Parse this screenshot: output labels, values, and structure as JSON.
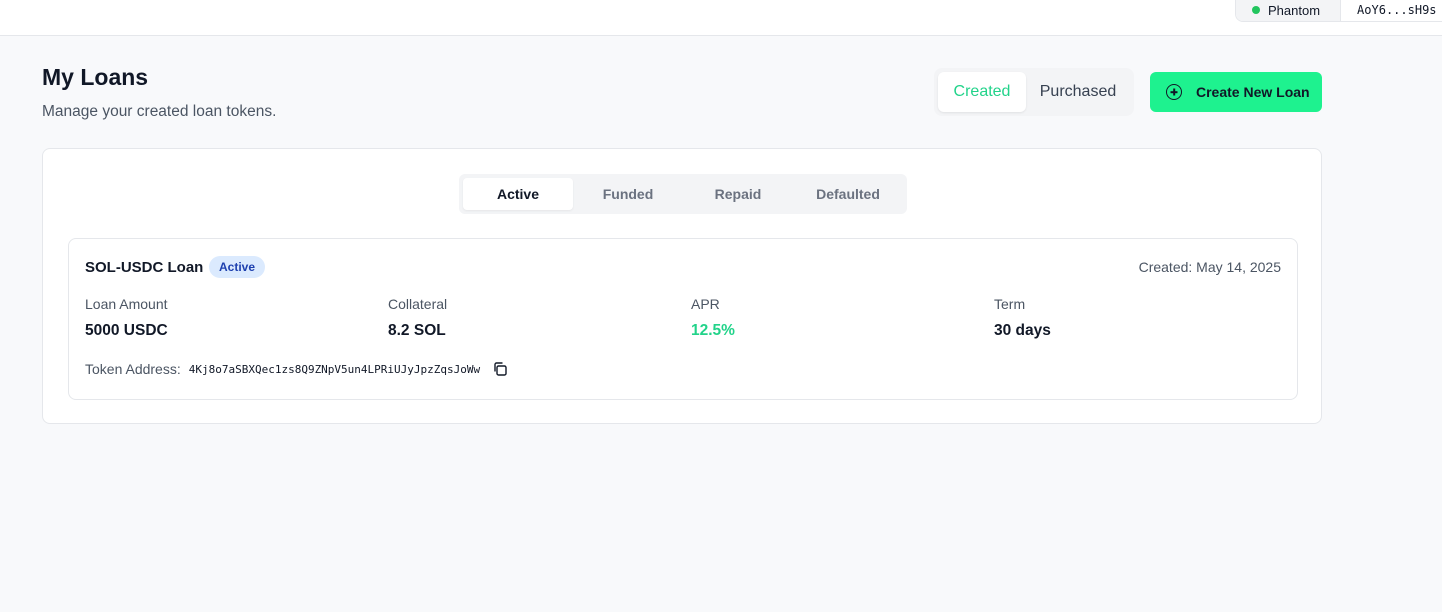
{
  "wallet": {
    "provider": "Phantom",
    "address": "AoY6...sH9s"
  },
  "header": {
    "title": "My Loans",
    "subtitle": "Manage your created loan tokens."
  },
  "view_toggle": {
    "options": [
      "Created",
      "Purchased"
    ],
    "selected": "Created"
  },
  "create_button": {
    "label": "Create New Loan",
    "icon": "plus-circle-icon"
  },
  "status_tabs": {
    "tabs": [
      "Active",
      "Funded",
      "Repaid",
      "Defaulted"
    ],
    "selected": "Active"
  },
  "loan": {
    "name": "SOL-USDC Loan",
    "status": "Active",
    "created": "Created: May 14, 2025",
    "metrics": [
      {
        "label": "Loan Amount",
        "value": "5000 USDC"
      },
      {
        "label": "Collateral",
        "value": "8.2 SOL"
      },
      {
        "label": "APR",
        "value": "12.5%"
      },
      {
        "label": "Term",
        "value": "30 days"
      }
    ],
    "token_label": "Token Address:",
    "token_address": "4Kj8o7aSBXQec1zs8Q9ZNpV5un4LPRiUJyJpzZqsJoWw"
  },
  "colors": {
    "accent": "#1ef28f",
    "accent_text": "#22d38a",
    "badge_bg": "#dbeafe",
    "badge_text": "#1e40af",
    "wallet_dot": "#22c55e"
  }
}
